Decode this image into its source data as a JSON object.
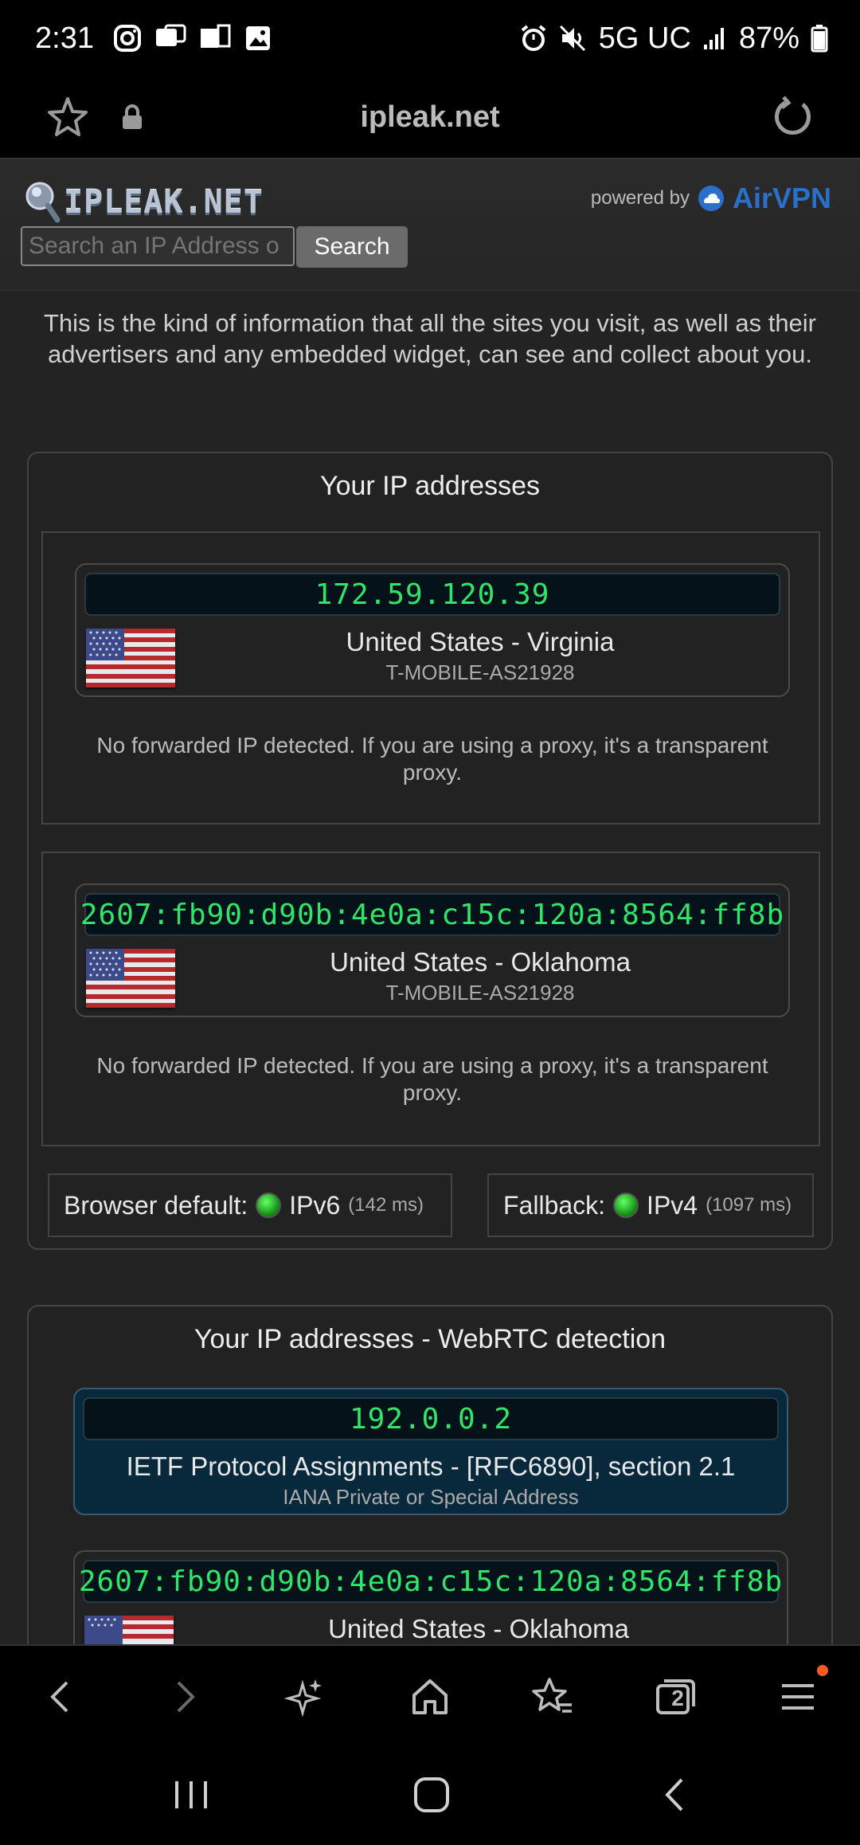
{
  "status_bar": {
    "time": "2:31",
    "network": "5G UC",
    "battery": "87%"
  },
  "url_bar": {
    "url": "ipleak.net"
  },
  "header": {
    "logo_text": "IPLEAK.NET",
    "powered_by": "powered by",
    "brand": "AirVPN",
    "search_placeholder": "Search an IP Address o",
    "search_button": "Search"
  },
  "intro_text": "This is the kind of information that all the sites you visit, as well as their advertisers and any embedded widget, can see and collect about you.",
  "ip_panel": {
    "title": "Your IP addresses",
    "entries": [
      {
        "ip": "172.59.120.39",
        "location": "United States - Virginia",
        "isp": "T-MOBILE-AS21928",
        "note": "No forwarded IP detected. If you are using a proxy, it's a transparent proxy."
      },
      {
        "ip": "2607:fb90:d90b:4e0a:c15c:120a:8564:ff8b",
        "location": "United States - Oklahoma",
        "isp": "T-MOBILE-AS21928",
        "note": "No forwarded IP detected. If you are using a proxy, it's a transparent proxy."
      }
    ],
    "browser_default_label": "Browser default:",
    "browser_default_proto": "IPv6",
    "browser_default_ms": "(142 ms)",
    "fallback_label": "Fallback:",
    "fallback_proto": "IPv4",
    "fallback_ms": "(1097 ms)"
  },
  "webrtc_panel": {
    "title": "Your IP addresses - WebRTC detection",
    "entries": [
      {
        "ip": "192.0.0.2",
        "location": "IETF Protocol Assignments - [RFC6890], section 2.1",
        "isp": "IANA Private or Special Address"
      },
      {
        "ip": "2607:fb90:d90b:4e0a:c15c:120a:8564:ff8b",
        "location": "United States - Oklahoma"
      }
    ]
  },
  "bottom_bar": {
    "tab_count": "2"
  },
  "colors": {
    "ip_green": "#2ee66a",
    "brand_blue": "#2a6fc9",
    "notification": "#ff5a1f"
  }
}
